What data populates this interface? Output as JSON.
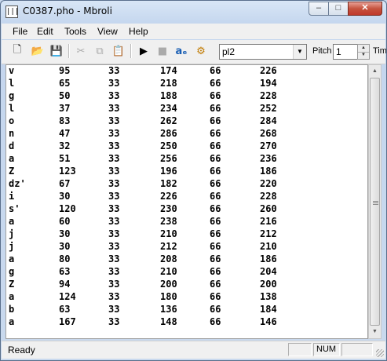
{
  "window": {
    "title": "C0387.pho - Mbroli",
    "app_icon_text": "|||",
    "controls": {
      "minimize": "–",
      "maximize": "□",
      "close": "✕"
    }
  },
  "menu": [
    "File",
    "Edit",
    "Tools",
    "View",
    "Help"
  ],
  "toolbar": {
    "icons": {
      "new": "🗋",
      "open": "📂",
      "save": "💾",
      "cut": "✂",
      "copy": "⧉",
      "paste": "📋",
      "play": "▶",
      "stop": "■",
      "ae": "aₑ",
      "settings": "⚙"
    },
    "voice_value": "pl2",
    "dropdown_arrow": "▼",
    "pitch_label": "Pitch",
    "pitch_value": "1",
    "spin_up": "▲",
    "spin_down": "▼",
    "time_label": "Tim"
  },
  "phonemes": [
    [
      "v",
      "95",
      "33",
      "174",
      "66",
      "226"
    ],
    [
      "l",
      "65",
      "33",
      "218",
      "66",
      "194"
    ],
    [
      "g",
      "50",
      "33",
      "188",
      "66",
      "228"
    ],
    [
      "l",
      "37",
      "33",
      "234",
      "66",
      "252"
    ],
    [
      "o",
      "83",
      "33",
      "262",
      "66",
      "284"
    ],
    [
      "n",
      "47",
      "33",
      "286",
      "66",
      "268"
    ],
    [
      "d",
      "32",
      "33",
      "250",
      "66",
      "270"
    ],
    [
      "a",
      "51",
      "33",
      "256",
      "66",
      "236"
    ],
    [
      "Z",
      "123",
      "33",
      "196",
      "66",
      "186"
    ],
    [
      "dz'",
      "67",
      "33",
      "182",
      "66",
      "220"
    ],
    [
      "i",
      "30",
      "33",
      "226",
      "66",
      "228"
    ],
    [
      "s'",
      "120",
      "33",
      "230",
      "66",
      "260"
    ],
    [
      "a",
      "60",
      "33",
      "238",
      "66",
      "216"
    ],
    [
      "j",
      "30",
      "33",
      "210",
      "66",
      "212"
    ],
    [
      "j",
      "30",
      "33",
      "212",
      "66",
      "210"
    ],
    [
      "a",
      "80",
      "33",
      "208",
      "66",
      "186"
    ],
    [
      "g",
      "63",
      "33",
      "210",
      "66",
      "204"
    ],
    [
      "Z",
      "94",
      "33",
      "200",
      "66",
      "200"
    ],
    [
      "a",
      "124",
      "33",
      "180",
      "66",
      "138"
    ],
    [
      "b",
      "63",
      "33",
      "136",
      "66",
      "184"
    ],
    [
      "a",
      "167",
      "33",
      "148",
      "66",
      "146"
    ]
  ],
  "scrollbar": {
    "up": "▲",
    "down": "▼"
  },
  "status": {
    "text": "Ready",
    "num": "NUM"
  }
}
